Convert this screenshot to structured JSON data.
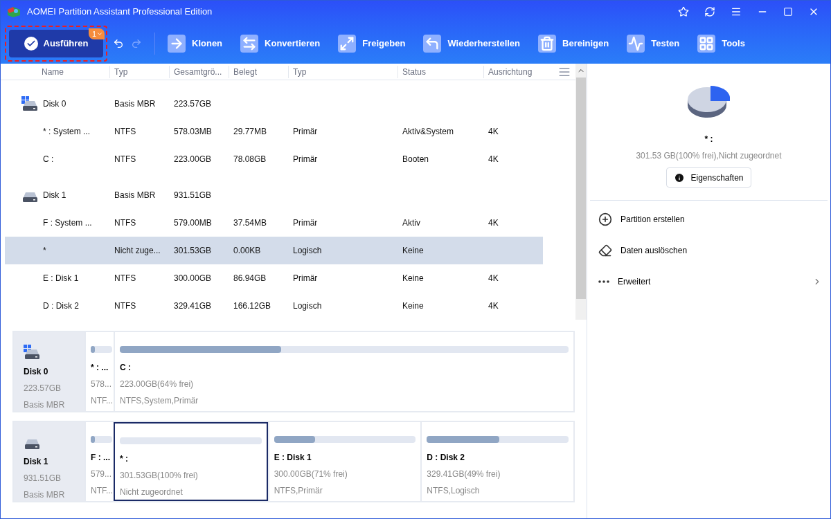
{
  "window": {
    "title": "AOMEI Partition Assistant Professional Edition"
  },
  "toolbar": {
    "execute": {
      "label": "Ausführen",
      "badge": "1"
    },
    "tools": [
      {
        "kind": "clone",
        "label": "Klonen"
      },
      {
        "kind": "convert",
        "label": "Konvertieren"
      },
      {
        "kind": "share",
        "label": "Freigeben"
      },
      {
        "kind": "restore",
        "label": "Wiederherstellen"
      },
      {
        "kind": "wipe",
        "label": "Bereinigen"
      },
      {
        "kind": "test",
        "label": "Testen"
      },
      {
        "kind": "tools",
        "label": "Tools"
      }
    ]
  },
  "table": {
    "columns": [
      "Name",
      "Typ",
      "Gesamtgrö...",
      "Belegt",
      "Typ",
      "Status",
      "Ausrichtung"
    ],
    "rows": [
      {
        "kind": "disk",
        "selected": false,
        "system": true,
        "cells": [
          "Disk 0",
          "Basis MBR",
          "223.57GB",
          "",
          "",
          "",
          ""
        ]
      },
      {
        "kind": "partition",
        "selected": false,
        "cells": [
          "* : System ...",
          "NTFS",
          "578.03MB",
          "29.77MB",
          "Primär",
          "Aktiv&System",
          "4K"
        ]
      },
      {
        "kind": "partition",
        "selected": false,
        "cells": [
          "C :",
          "NTFS",
          "223.00GB",
          "78.08GB",
          "Primär",
          "Booten",
          "4K"
        ]
      },
      {
        "kind": "disk",
        "selected": false,
        "system": false,
        "cells": [
          "Disk 1",
          "Basis MBR",
          "931.51GB",
          "",
          "",
          "",
          ""
        ]
      },
      {
        "kind": "partition",
        "selected": false,
        "cells": [
          "F : System ...",
          "NTFS",
          "579.00MB",
          "37.54MB",
          "Primär",
          "Aktiv",
          "4K"
        ]
      },
      {
        "kind": "partition",
        "selected": true,
        "cells": [
          "*",
          "Nicht zuge...",
          "301.53GB",
          "0.00KB",
          "Logisch",
          "Keine",
          ""
        ]
      },
      {
        "kind": "partition",
        "selected": false,
        "cells": [
          "E : Disk 1",
          "NTFS",
          "300.00GB",
          "86.94GB",
          "Primär",
          "Keine",
          "4K"
        ]
      },
      {
        "kind": "partition",
        "selected": false,
        "cells": [
          "D : Disk 2",
          "NTFS",
          "329.41GB",
          "166.12GB",
          "Logisch",
          "Keine",
          "4K"
        ]
      }
    ]
  },
  "disk_map": [
    {
      "name": "Disk 0",
      "system": true,
      "size": "223.57GB",
      "type": "Basis MBR",
      "partitions": [
        {
          "kind": "narrow",
          "selected": false,
          "level": 0.2,
          "name": "* : ...",
          "size": "578...",
          "info": "NTF..."
        },
        {
          "kind": "wide",
          "selected": false,
          "level": 0.36,
          "name": "C :",
          "size": "223.00GB(64% frei)",
          "info": "NTFS,System,Primär"
        }
      ]
    },
    {
      "name": "Disk 1",
      "system": false,
      "size": "931.51GB",
      "type": "Basis MBR",
      "partitions": [
        {
          "kind": "narrow",
          "selected": false,
          "level": 0.2,
          "name": "F : ...",
          "size": "579...",
          "info": "NTF..."
        },
        {
          "kind": "wide",
          "selected": true,
          "level": 0,
          "name": "* :",
          "size": "301.53GB(100% frei)",
          "info": "Nicht zugeordnet"
        },
        {
          "kind": "wide",
          "selected": false,
          "level": 0.29,
          "name": "E : Disk 1",
          "size": "300.00GB(71% frei)",
          "info": "NTFS,Primär"
        },
        {
          "kind": "wide",
          "selected": false,
          "level": 0.51,
          "name": "D : Disk 2",
          "size": "329.41GB(49% frei)",
          "info": "NTFS,Logisch"
        }
      ]
    }
  ],
  "details": {
    "name": "* :",
    "info": "301.53 GB(100% frei),Nicht zugeordnet",
    "button": "Eigenschaften",
    "actions": [
      {
        "kind": "create",
        "label": "Partition erstellen",
        "submenu": false
      },
      {
        "kind": "wipe",
        "label": "Daten auslöschen",
        "submenu": false
      },
      {
        "kind": "more",
        "label": "Erweitert",
        "submenu": true
      }
    ]
  }
}
